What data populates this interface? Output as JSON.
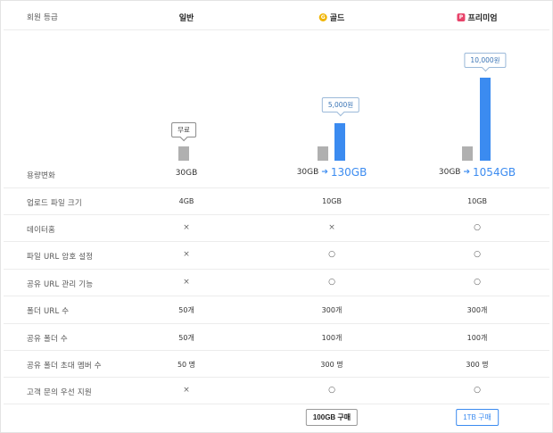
{
  "header": {
    "label": "회원 등급",
    "plans": [
      {
        "name": "일반",
        "badge": ""
      },
      {
        "name": "골드",
        "badge": "G"
      },
      {
        "name": "프리미엄",
        "badge": "P"
      }
    ]
  },
  "price_tags": [
    "무료",
    "5,000원",
    "10,000원"
  ],
  "capacity": {
    "label": "용량변화",
    "basic": "30GB",
    "gold_from": "30GB",
    "gold_to": "130GB",
    "prem_from": "30GB",
    "prem_to": "1054GB",
    "arrow": "➔"
  },
  "bar_levels": {
    "base_gb": 30,
    "gold_gb": 130,
    "prem_gb": 1054
  },
  "rows": [
    {
      "label": "업로드 파일 크기",
      "values": [
        "4GB",
        "10GB",
        "10GB"
      ]
    },
    {
      "label": "데이터홈",
      "values": [
        "×",
        "×",
        "○"
      ]
    },
    {
      "label": "파일 URL 암호 설정",
      "values": [
        "×",
        "○",
        "○"
      ]
    },
    {
      "label": "공유 URL 관리 기능",
      "values": [
        "×",
        "○",
        "○"
      ]
    },
    {
      "label": "폴더 URL 수",
      "values": [
        "50개",
        "300개",
        "300개"
      ]
    },
    {
      "label": "공유 폴더 수",
      "values": [
        "50개",
        "100개",
        "100개"
      ]
    },
    {
      "label": "공유 폴더 초대 멤버 수",
      "values": [
        "50 명",
        "300 명",
        "300 명"
      ]
    },
    {
      "label": "고객 문의 우선 지원",
      "values": [
        "×",
        "○",
        "○"
      ]
    }
  ],
  "buttons": {
    "gold": "100GB 구매",
    "prem": "1TB 구매"
  }
}
